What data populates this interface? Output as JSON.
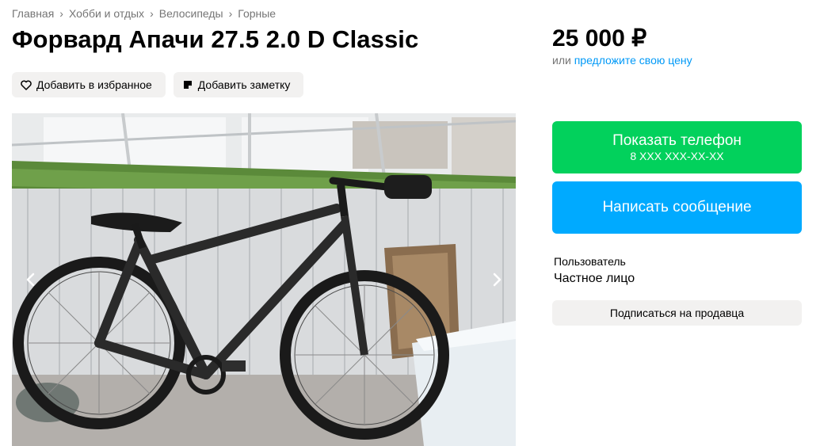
{
  "breadcrumb": [
    "Главная",
    "Хобби и отдых",
    "Велосипеды",
    "Горные"
  ],
  "title": "Форвард Апачи 27.5 2.0 D Classic",
  "actions": {
    "favorite_label": "Добавить в избранное",
    "note_label": "Добавить заметку"
  },
  "price": {
    "value": "25 000 ₽",
    "offer_prefix": "или",
    "offer_link": "предложите свою цену"
  },
  "contact": {
    "phone_label": "Показать телефон",
    "phone_masked": "8 XXX XXX-XX-XX",
    "message_label": "Написать сообщение"
  },
  "seller": {
    "label": "Пользователь",
    "type": "Частное лицо",
    "subscribe_label": "Подписаться на продавца"
  },
  "colors": {
    "phone_button": "#02d15c",
    "message_button": "#00aaff",
    "link": "#0099f7",
    "chip_bg": "#f2f1f0"
  },
  "icons": [
    "heart-icon",
    "note-icon",
    "chevron-left-icon",
    "chevron-right-icon",
    "chevron-right-separator-icon"
  ]
}
